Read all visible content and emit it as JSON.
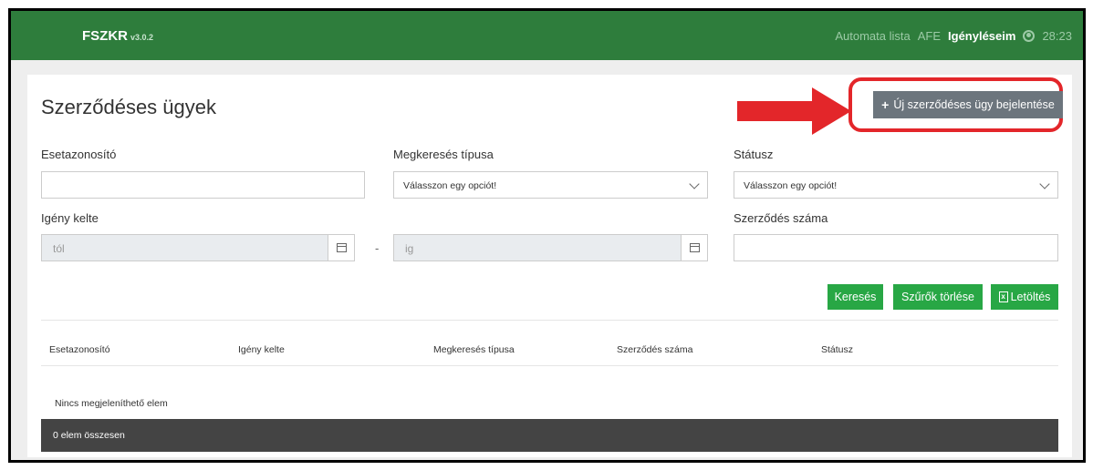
{
  "header": {
    "brand": "FSZKR",
    "version": "v3.0.2",
    "nav": [
      "Automata lista",
      "AFE",
      "Igényléseim"
    ],
    "user_icon": "user-circle-icon",
    "timer": "28:23",
    "bg_color": "#2e7d3c"
  },
  "page": {
    "title": "Szerződéses ügyek",
    "new_button": "Új szerződéses ügy bejelentése",
    "highlight_color": "#e3262a"
  },
  "filters": {
    "case_id_label": "Esetazonosító",
    "request_type_label": "Megkeresés típusa",
    "request_type_value": "Válasszon egy opciót!",
    "status_label": "Státusz",
    "status_value": "Válasszon egy opciót!",
    "date_label": "Igény kelte",
    "date_from_placeholder": "tól",
    "date_to_placeholder": "ig",
    "date_separator": "-",
    "contract_number_label": "Szerződés száma"
  },
  "actions": {
    "search": "Keresés",
    "clear": "Szűrők törlése",
    "download": "Letöltés"
  },
  "table": {
    "columns": [
      "Esetazonosító",
      "Igény kelte",
      "Megkeresés típusa",
      "Szerződés száma",
      "Státusz"
    ],
    "empty_text": "Nincs megjeleníthető elem",
    "footer_text": "0 elem összesen"
  }
}
